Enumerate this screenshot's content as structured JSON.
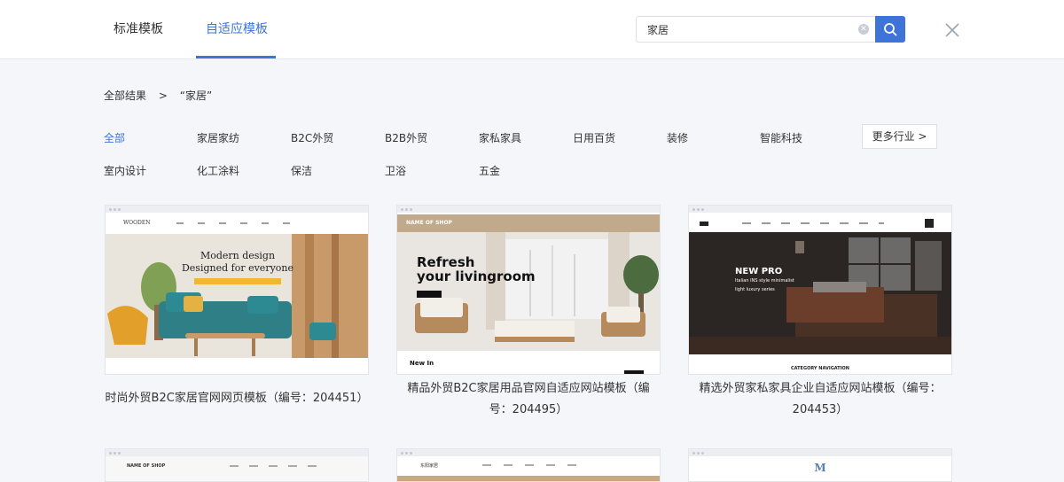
{
  "header": {
    "tabs": [
      {
        "label": "标准模板",
        "active": false
      },
      {
        "label": "自适应模板",
        "active": true
      }
    ]
  },
  "search": {
    "value": "家居",
    "icons": {
      "clear": "clear-icon",
      "search": "search-icon",
      "close": "close-icon"
    }
  },
  "breadcrumb": {
    "root": "全部结果",
    "separator": ">",
    "current": "“家居”"
  },
  "filters": {
    "row1": [
      "全部",
      "家居家纺",
      "B2C外贸",
      "B2B外贸",
      "家私家具",
      "日用百货",
      "装修",
      "智能科技"
    ],
    "row2": [
      "室内设计",
      "化工涂料",
      "保洁",
      "卫浴",
      "五金"
    ],
    "active": "全部",
    "more_label": "更多行业 >"
  },
  "templates": [
    {
      "title": "时尚外贸B2C家居官网网页模板（编号：204451）",
      "preview": {
        "brand": "WOODEN",
        "headline1": "Modern design",
        "headline2": "Designed for everyone"
      }
    },
    {
      "title": "精品外贸B2C家居用品官网自适应网站模板（编号：204495）",
      "preview": {
        "brand": "NAME OF SHOP",
        "headline1": "Refresh",
        "headline2": "your livingroom",
        "footer_text": "New In"
      }
    },
    {
      "title": "精选外贸家私家具企业自适应网站模板（编号：204453）",
      "preview": {
        "headline1": "NEW PRO",
        "headline2": "Italian INS style minimalist",
        "headline3": "light luxury series",
        "footer_text": "CATEGORY NAVIGATION"
      }
    }
  ],
  "row2_templates": [
    {
      "brand": "NAME OF SHOP"
    },
    {
      "brand": "东阳家居"
    },
    {
      "brand": "M"
    }
  ],
  "colors": {
    "accent": "#3e74d8",
    "background": "#f5f6fa"
  }
}
